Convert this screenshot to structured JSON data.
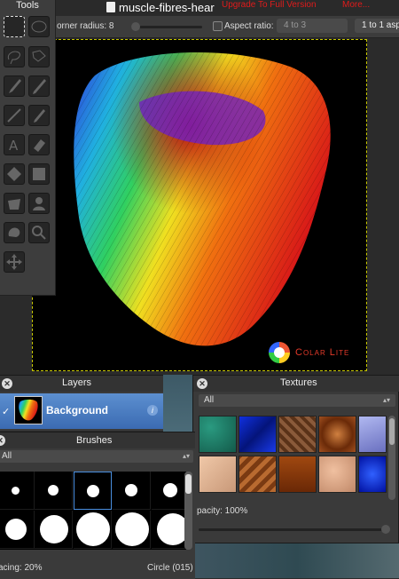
{
  "window": {
    "document_title": "muscle-fibres-hear",
    "upgrade_label": "Upgrade To Full Version",
    "more_label": "More..."
  },
  "options_bar": {
    "corner_radius_label": "orner radius: 8",
    "aspect_ratio_label": "Aspect ratio:",
    "aspect_ratio_value": "4 to 3",
    "zoom_value": "1 to 1 asp"
  },
  "canvas": {
    "watermark_text": "Colar Lite",
    "selection_color": "#c9c900"
  },
  "tools_panel": {
    "title": "Tools",
    "tools": [
      "rect-select",
      "ellipse-select",
      "lasso",
      "poly-lasso",
      "brush",
      "pencil",
      "line",
      "pen",
      "text",
      "eraser",
      "fill",
      "shape",
      "stamp",
      "person",
      "smudge",
      "magnifier",
      "move"
    ]
  },
  "layers_panel": {
    "title": "Layers",
    "layers": [
      {
        "name": "Background",
        "visible": true
      }
    ]
  },
  "textures_panel": {
    "title": "Textures",
    "filter": "All",
    "opacity_label": "pacity: 100%",
    "opacity": 1.0,
    "swatch_colors": [
      [
        "#1f7a6a",
        "#0a2bbd",
        "#7a4a2a",
        "#7a3a10",
        "#9aa0d8"
      ],
      [
        "#d8b090",
        "#a05a28",
        "#8a3a0a",
        "#d8a080",
        "#1a40e0"
      ]
    ]
  },
  "brushes_panel": {
    "title": "Brushes",
    "filter": "All",
    "spacing_label": "acing: 20%",
    "brush_name": "Circle (015)",
    "selected_index": 2
  }
}
